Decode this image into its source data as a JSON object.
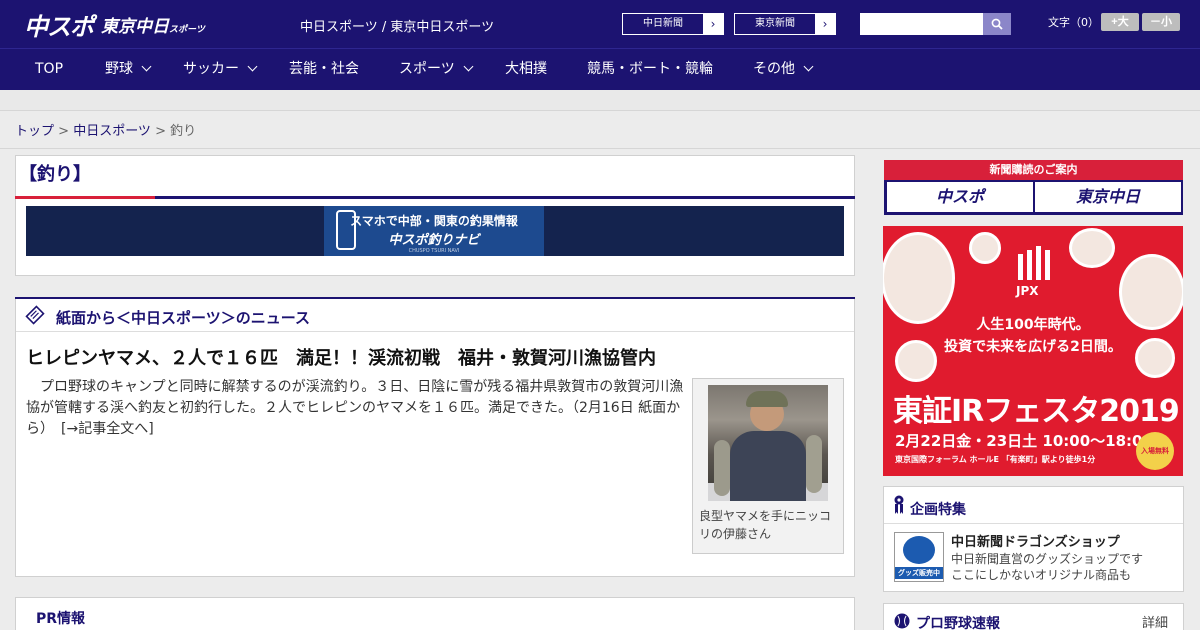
{
  "header": {
    "logo_main": "中スポ",
    "logo_sub": "東京中日",
    "logo_sub_small": "スポーツ",
    "tagline": "中日スポーツ / 東京中日スポーツ",
    "link_chunichi": "中日新聞",
    "link_tokyo": "東京新聞",
    "search_placeholder": "",
    "font_label": "文字（0）",
    "font_large": "+大",
    "font_small": "－小"
  },
  "nav": {
    "items": [
      "TOP",
      "野球",
      "サッカー",
      "芸能・社会",
      "スポーツ",
      "大相撲",
      "競馬・ボート・競輪",
      "その他"
    ]
  },
  "breadcrumb": {
    "top": "トップ",
    "sep": " > ",
    "section": "中日スポーツ",
    "current": "釣り"
  },
  "category": {
    "title": "【釣り】"
  },
  "banner": {
    "line1": "スマホで中部・関東の釣果情報",
    "line2": "中スポ釣りナビ",
    "line3": "CHUSPO TSURI NAVI"
  },
  "news": {
    "heading": "紙面から＜中日スポーツ＞のニュース",
    "article_title": "ヒレピンヤマメ、２人で１６匹　満足！！渓流初戦　福井・敦賀河川漁協管内",
    "article_body": "プロ野球のキャンプと同時に解禁するのが渓流釣り。３日、日陰に雪が残る福井県敦賀市の敦賀河川漁協が管轄する渓へ釣友と初釣行した。２人でヒレピンのヤマメを１６匹。満足できた。（2月16日 紙面から）",
    "read_more": "[→記事全文へ]",
    "photo_caption": "良型ヤマメを手にニッコリの伊藤さん"
  },
  "pr": {
    "label": "PR情報"
  },
  "sidebar": {
    "subscribe_title": "新聞購読のご案内",
    "subscribe_btn1": "中スポ",
    "subscribe_btn2": "東京中日",
    "ad": {
      "brand": "JPX",
      "line1": "人生100年時代。",
      "line2": "投資で未来を広げる2日間。",
      "main": "東証IRフェスタ2019",
      "date": "2月22日金・23日土 10:00～18:00",
      "venue": "東京国際フォーラム ホールE 「有楽町」駅より徒歩1分",
      "free": "入場無料"
    },
    "feature_head": "企画特集",
    "feature_title": "中日新聞ドラゴンズショップ",
    "feature_desc1": "中日新聞直営のグッズショップです",
    "feature_desc2": "ここにしかないオリジナル商品も",
    "feature_img_label": "グッズ販売中",
    "pro_head": "プロ野球速報",
    "pro_detail": "詳細 ＞"
  },
  "colors": {
    "brand_navy": "#1c1371",
    "accent_red": "#d8203a"
  }
}
